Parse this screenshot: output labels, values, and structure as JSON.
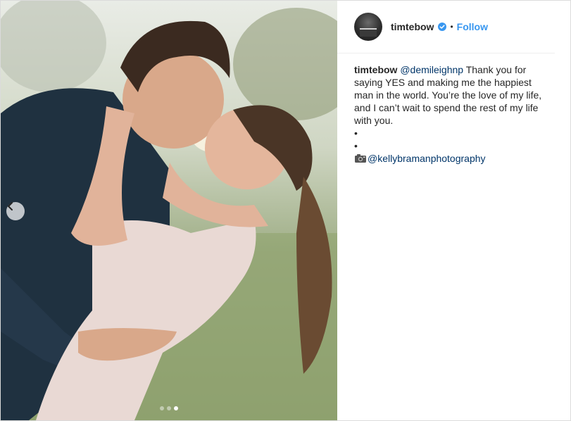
{
  "post": {
    "username": "timtebow",
    "follow_label": "Follow",
    "separator": "•",
    "verified_icon": "verified-badge-icon",
    "avatar_text": "THIS IS TIM TEBOW"
  },
  "caption": {
    "username": "timtebow",
    "mention": "@demileighnp",
    "text": " Thank you for saying YES and making me the happiest man in the world. You’re the love of my life, and I can’t wait to spend the rest of my life with you.",
    "bullet_1": "•",
    "bullet_2": "•",
    "credit_mention": "@kellybramanphotography",
    "credit_icon": "camera-icon"
  },
  "carousel": {
    "prev_icon": "chevron-left-icon",
    "dots": 3,
    "active_dot_index": 2
  },
  "colors": {
    "accent": "#3897f0",
    "mention": "#003569",
    "text": "#262626",
    "border": "#dbdbdb"
  }
}
